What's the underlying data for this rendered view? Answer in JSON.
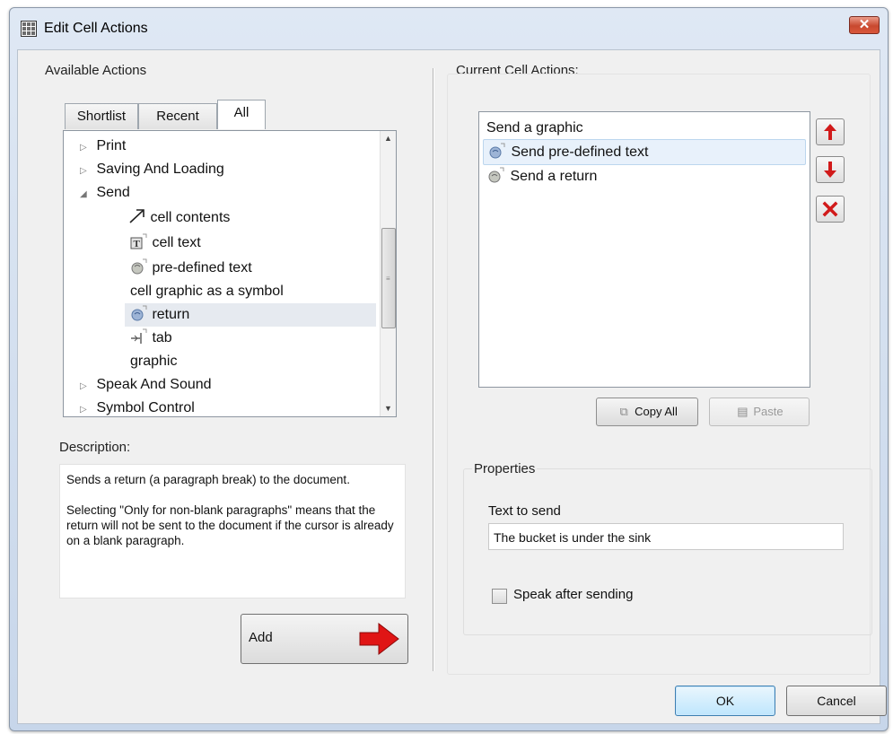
{
  "window": {
    "title": "Edit Cell Actions",
    "close_label": "✕"
  },
  "available": {
    "label": "Available Actions",
    "tabs": [
      {
        "label": "Shortlist"
      },
      {
        "label": "Recent"
      },
      {
        "label": "All"
      }
    ],
    "active_tab": "All",
    "tree": [
      {
        "label": "Print",
        "level": 0,
        "expander": "▷"
      },
      {
        "label": "Saving And Loading",
        "level": 0,
        "expander": "▷"
      },
      {
        "label": "Send",
        "level": 0,
        "expander": "◢"
      },
      {
        "label": "cell contents",
        "level": 1,
        "icon": "arrow-icon"
      },
      {
        "label": "cell text",
        "level": 1,
        "icon": "text-icon"
      },
      {
        "label": "pre-defined text",
        "level": 1,
        "icon": "speech-icon"
      },
      {
        "label": "cell graphic as a symbol",
        "level": 1,
        "icon": ""
      },
      {
        "label": "return",
        "level": 1,
        "icon": "return-icon",
        "selected": true
      },
      {
        "label": "tab",
        "level": 1,
        "icon": "tab-icon"
      },
      {
        "label": "graphic",
        "level": 1,
        "icon": ""
      },
      {
        "label": "Speak And Sound",
        "level": 0,
        "expander": "▷"
      },
      {
        "label": "Symbol Control",
        "level": 0,
        "expander": "▷"
      }
    ]
  },
  "description": {
    "label": "Description:",
    "paragraph1": "Sends a return (a paragraph break) to the document.",
    "paragraph2": "Selecting \"Only for non-blank paragraphs\" means that the return will not be sent to the document if the cursor is already on a blank paragraph."
  },
  "add_button": {
    "label": "Add"
  },
  "current": {
    "label": "Current Cell Actions:",
    "items": [
      {
        "label": "Send a graphic",
        "icon": ""
      },
      {
        "label": "Send pre-defined text",
        "icon": "speech-icon",
        "selected": true
      },
      {
        "label": "Send a return",
        "icon": "return-icon"
      }
    ],
    "copy_all_label": "Copy All",
    "paste_label": "Paste"
  },
  "properties": {
    "label": "Properties",
    "text_to_send_label": "Text to send",
    "text_to_send_value": "The bucket is under the sink",
    "speak_after_label": "Speak after sending",
    "speak_after_checked": false
  },
  "dialog_buttons": {
    "ok": "OK",
    "cancel": "Cancel"
  },
  "colors": {
    "accent_red": "#d11a1a",
    "selection": "#e8f1fb"
  }
}
